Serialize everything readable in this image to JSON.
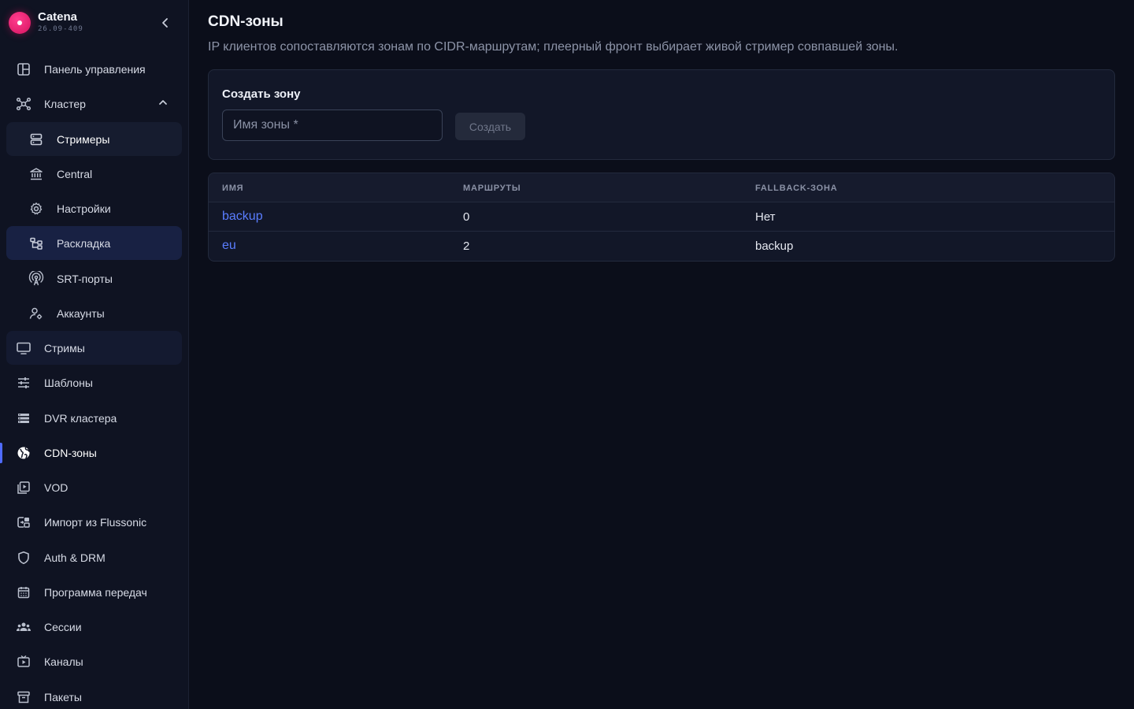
{
  "brand": {
    "name": "Catena",
    "version": "26.09-409"
  },
  "nav": {
    "dashboard": "Панель управления",
    "cluster": "Кластер",
    "streamers": "Стримеры",
    "central": "Central",
    "settings": "Настройки",
    "layout": "Раскладка",
    "srt_ports": "SRT-порты",
    "accounts": "Аккаунты",
    "streams": "Стримы",
    "templates": "Шаблоны",
    "dvr": "DVR кластера",
    "cdn_zones": "CDN-зоны",
    "vod": "VOD",
    "import": "Импорт из Flussonic",
    "auth": "Auth & DRM",
    "epg": "Программа передач",
    "sessions": "Сессии",
    "channels": "Каналы",
    "packages": "Пакеты"
  },
  "page": {
    "title": "CDN-зоны",
    "description": "IP клиентов сопоставляются зонам по CIDR-маршрутам; плеерный фронт выбирает живой стример совпавшей зоны."
  },
  "create_form": {
    "title": "Создать зону",
    "input_placeholder": "Имя зоны *",
    "input_value": "",
    "button_label": "Создать"
  },
  "table": {
    "columns": [
      "ИМЯ",
      "МАРШРУТЫ",
      "FALLBACK-ЗОНА"
    ],
    "rows": [
      {
        "name": "backup",
        "routes": "0",
        "fallback": "Нет"
      },
      {
        "name": "eu",
        "routes": "2",
        "fallback": "backup"
      }
    ]
  },
  "colors": {
    "accent": "#4f6bff",
    "link": "#5a7dff",
    "logo": "#e8176e",
    "background": "#0b0e1a"
  }
}
